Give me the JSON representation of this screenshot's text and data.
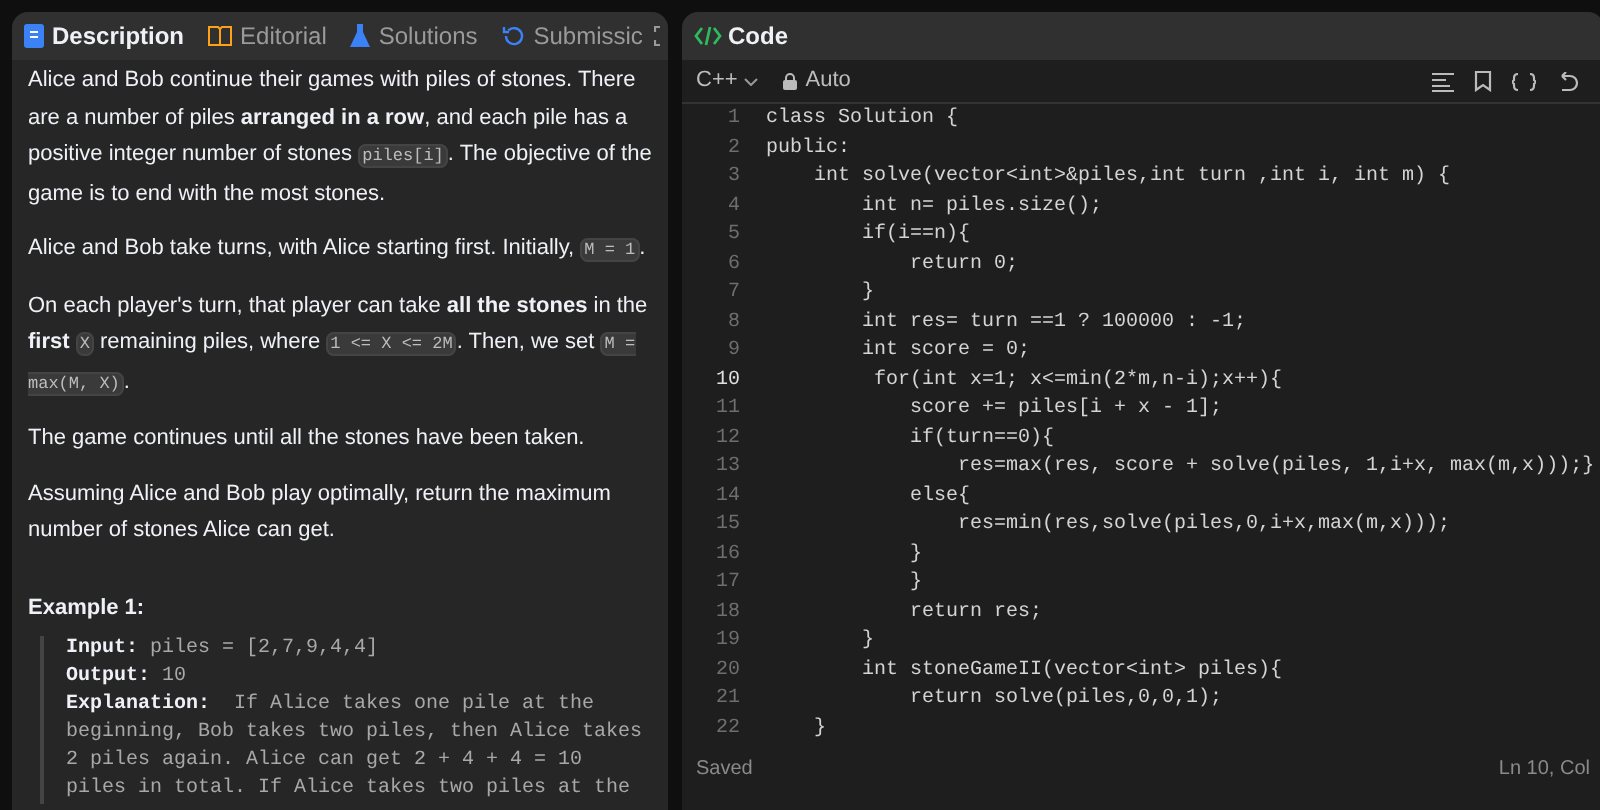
{
  "description_panel": {
    "tabs": [
      {
        "label": "Description",
        "selected": true
      },
      {
        "label": "Editorial",
        "selected": false
      },
      {
        "label": "Solutions",
        "selected": false
      },
      {
        "label": "Submissic",
        "selected": false
      }
    ],
    "paragraphs": [
      [
        {
          "kind": "text",
          "text": "Alice and Bob continue their games with piles of stones.  There are a number of piles **arranged in a row**, and each pile has a positive integer number of stones "
        },
        {
          "kind": "code",
          "text": "piles[i]"
        },
        {
          "kind": "text",
          "text": ".  The objective of the game is to end with the most stones."
        }
      ],
      [
        {
          "kind": "text",
          "text": "Alice and Bob take turns, with Alice starting first.  Initially, "
        },
        {
          "kind": "code",
          "text": "M = 1"
        },
        {
          "kind": "text",
          "text": "."
        }
      ],
      [
        {
          "kind": "text",
          "text": "On each player's turn, that player can take **all the stones** in the **first** "
        },
        {
          "kind": "code",
          "text": "X"
        },
        {
          "kind": "text",
          "text": " remaining piles, where "
        },
        {
          "kind": "code",
          "text": "1 <= X <= 2M"
        },
        {
          "kind": "text",
          "text": ".  Then, we set "
        },
        {
          "kind": "code",
          "text": "M = max(M, X)"
        },
        {
          "kind": "text",
          "text": "."
        }
      ],
      [
        {
          "kind": "text",
          "text": "The game continues until all the stones have been taken."
        }
      ],
      [
        {
          "kind": "text",
          "text": "Assuming Alice and Bob play optimally, return the maximum number of stones Alice can get."
        }
      ]
    ],
    "example": {
      "title": "Example 1:",
      "lines": [
        {
          "label": "Input:",
          "value": "piles = [2,7,9,4,4]"
        },
        {
          "label": "Output:",
          "value": "10"
        },
        {
          "label": "Explanation:",
          "value": " If Alice takes one pile at the beginning, Bob takes two piles, then Alice takes 2 piles again. Alice can get 2 + 4 + 4 = 10 piles in total. If Alice takes two piles at the"
        }
      ]
    }
  },
  "code_panel": {
    "title": "Code",
    "language": "C++",
    "mode": "Auto",
    "lines": [
      {
        "number": "1",
        "text": "class Solution {",
        "current": false
      },
      {
        "number": "2",
        "text": "public:",
        "current": false
      },
      {
        "number": "3",
        "text": "    int solve(vector<int>&piles,int turn ,int i, int m) {",
        "current": false
      },
      {
        "number": "4",
        "text": "        int n= piles.size();",
        "current": false
      },
      {
        "number": "5",
        "text": "        if(i==n){",
        "current": false
      },
      {
        "number": "6",
        "text": "            return 0;",
        "current": false
      },
      {
        "number": "7",
        "text": "        }",
        "current": false
      },
      {
        "number": "8",
        "text": "        int res= turn ==1 ? 100000 : -1;",
        "current": false
      },
      {
        "number": "9",
        "text": "        int score = 0;",
        "current": false
      },
      {
        "number": "10",
        "text": "         for(int x=1; x<=min(2*m,n-i);x++){",
        "current": true
      },
      {
        "number": "11",
        "text": "            score += piles[i + x - 1];",
        "current": false
      },
      {
        "number": "12",
        "text": "            if(turn==0){",
        "current": false
      },
      {
        "number": "13",
        "text": "                res=max(res, score + solve(piles, 1,i+x, max(m,x)));}",
        "current": false
      },
      {
        "number": "14",
        "text": "            else{",
        "current": false
      },
      {
        "number": "15",
        "text": "                res=min(res,solve(piles,0,i+x,max(m,x)));",
        "current": false
      },
      {
        "number": "16",
        "text": "            }",
        "current": false
      },
      {
        "number": "17",
        "text": "            }",
        "current": false
      },
      {
        "number": "18",
        "text": "            return res;",
        "current": false
      },
      {
        "number": "19",
        "text": "        }",
        "current": false
      },
      {
        "number": "20",
        "text": "        int stoneGameII(vector<int> piles){",
        "current": false
      },
      {
        "number": "21",
        "text": "            return solve(piles,0,0,1);",
        "current": false
      },
      {
        "number": "22",
        "text": "    }",
        "current": false
      }
    ],
    "status": "Saved",
    "cursor": "Ln 10, Col"
  }
}
